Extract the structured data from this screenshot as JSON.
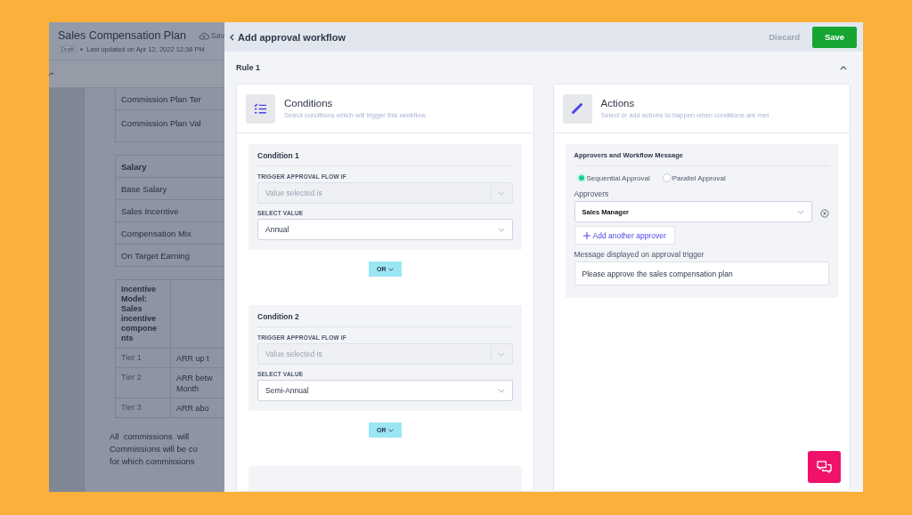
{
  "document": {
    "title": "Sales Compensation Plan",
    "save_label": "Sav",
    "status": "Draft",
    "updated": "Last updated on Apr 12, 2022 12:38 PM",
    "top_rows": [
      "Commission Plan Ter",
      "Commission Plan Val"
    ],
    "salary_table": {
      "heading": "Salary",
      "rows": [
        "Base Salary",
        "Sales Incentive",
        "Compensation Mix",
        "On Target Earning"
      ]
    },
    "incentive_table": {
      "heading": "Incentive Model: Sales incentive compone nts",
      "rows": [
        {
          "tier": "Tier 1",
          "text": "ARR up t"
        },
        {
          "tier": "Tier 2",
          "text": "ARR betw Month"
        },
        {
          "tier": "Tier 3",
          "text": "ARR abo"
        }
      ]
    },
    "paragraph_lines": [
      "All  commissions  will",
      "Commissions will be co",
      "for which commissions"
    ]
  },
  "workflow": {
    "title": "Add approval workflow",
    "discard": "Discard",
    "save": "Save",
    "rule": "Rule 1",
    "expanded": true,
    "conditions": {
      "title": "Conditions",
      "subtitle": "Select conditions which will trigger this workflow",
      "items": [
        {
          "title": "Condition 1",
          "trigger_label": "TRIGGER APPROVAL FLOW IF",
          "trigger_value": "Value selected is",
          "value_label": "SELECT VALUE",
          "value": "Annual",
          "connector": "OR"
        },
        {
          "title": "Condition 2",
          "trigger_label": "TRIGGER APPROVAL FLOW IF",
          "trigger_value": "Value selected is",
          "value_label": "SELECT VALUE",
          "value": "Semi-Annual",
          "connector": "OR"
        }
      ]
    },
    "actions": {
      "title": "Actions",
      "subtitle": "Select or add actions to happen when conditions are met",
      "section_title": "Approvers and Workflow Message",
      "modes": [
        {
          "label": "Sequential Approval",
          "selected": true
        },
        {
          "label": "Parallel Approval",
          "selected": false
        }
      ],
      "approvers_label": "Approvers",
      "approvers": [
        "Sales Manager"
      ],
      "add_label": "Add another approver",
      "message_label": "Message displayed on approval trigger",
      "message_value": "Please approve the sales compensation plan"
    }
  }
}
